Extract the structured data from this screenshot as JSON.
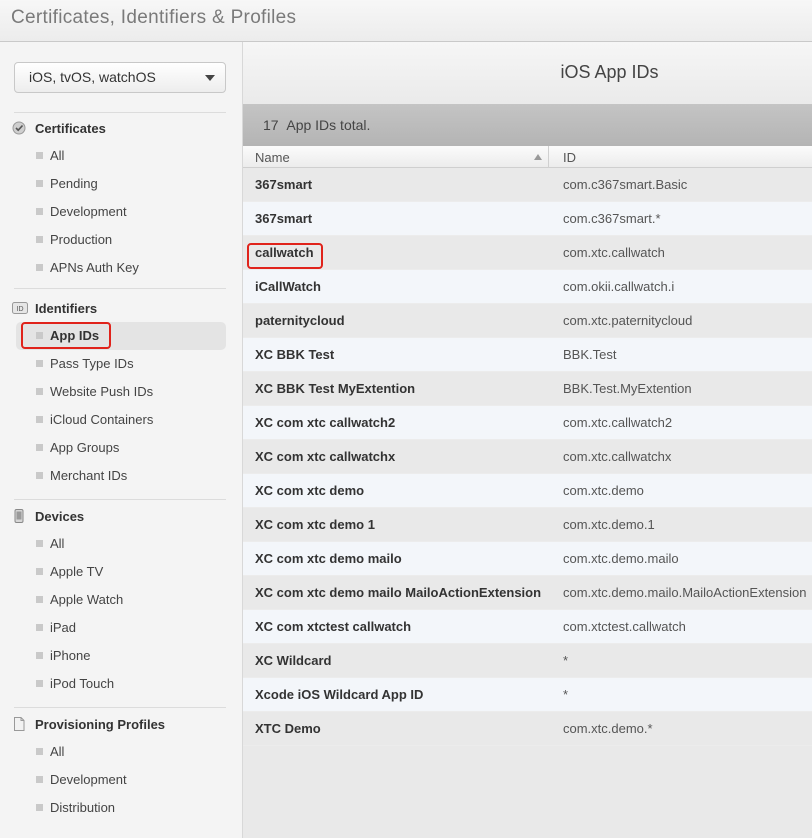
{
  "header": {
    "title": "Certificates, Identifiers & Profiles"
  },
  "platform_select": {
    "value": "iOS, tvOS, watchOS"
  },
  "sidebar": {
    "certificates": {
      "heading": "Certificates",
      "items": [
        "All",
        "Pending",
        "Development",
        "Production",
        "APNs Auth Key"
      ]
    },
    "identifiers": {
      "heading": "Identifiers",
      "icon_text": "ID",
      "items": [
        "App IDs",
        "Pass Type IDs",
        "Website Push IDs",
        "iCloud Containers",
        "App Groups",
        "Merchant IDs"
      ],
      "selected": "App IDs"
    },
    "devices": {
      "heading": "Devices",
      "items": [
        "All",
        "Apple TV",
        "Apple Watch",
        "iPad",
        "iPhone",
        "iPod Touch"
      ]
    },
    "provisioning": {
      "heading": "Provisioning Profiles",
      "items": [
        "All",
        "Development",
        "Distribution"
      ]
    }
  },
  "main": {
    "title": "iOS App IDs",
    "count": "17",
    "count_label": "App IDs total.",
    "columns": {
      "name": "Name",
      "id": "ID"
    },
    "rows": [
      {
        "name": "367smart",
        "id": "com.c367smart.Basic"
      },
      {
        "name": "367smart",
        "id": "com.c367smart.*"
      },
      {
        "name": "callwatch",
        "id": "com.xtc.callwatch"
      },
      {
        "name": "iCallWatch",
        "id": "com.okii.callwatch.i"
      },
      {
        "name": "paternitycloud",
        "id": "com.xtc.paternitycloud"
      },
      {
        "name": "XC BBK Test",
        "id": "BBK.Test"
      },
      {
        "name": "XC BBK Test MyExtention",
        "id": "BBK.Test.MyExtention"
      },
      {
        "name": "XC com xtc callwatch2",
        "id": "com.xtc.callwatch2"
      },
      {
        "name": "XC com xtc callwatchx",
        "id": "com.xtc.callwatchx"
      },
      {
        "name": "XC com xtc demo",
        "id": "com.xtc.demo"
      },
      {
        "name": "XC com xtc demo 1",
        "id": "com.xtc.demo.1"
      },
      {
        "name": "XC com xtc demo mailo",
        "id": "com.xtc.demo.mailo"
      },
      {
        "name": "XC com xtc demo mailo MailoActionExtension",
        "id": "com.xtc.demo.mailo.MailoActionExtension"
      },
      {
        "name": "XC com xtctest callwatch",
        "id": "com.xtctest.callwatch"
      },
      {
        "name": "XC Wildcard",
        "id": "*"
      },
      {
        "name": "Xcode iOS Wildcard App ID",
        "id": "*"
      },
      {
        "name": "XTC Demo",
        "id": "com.xtc.demo.*"
      }
    ]
  },
  "colors": {
    "highlight": "#e0231b",
    "alt_row": "#f3f6fa",
    "count_bar": "#bbbbbb"
  }
}
